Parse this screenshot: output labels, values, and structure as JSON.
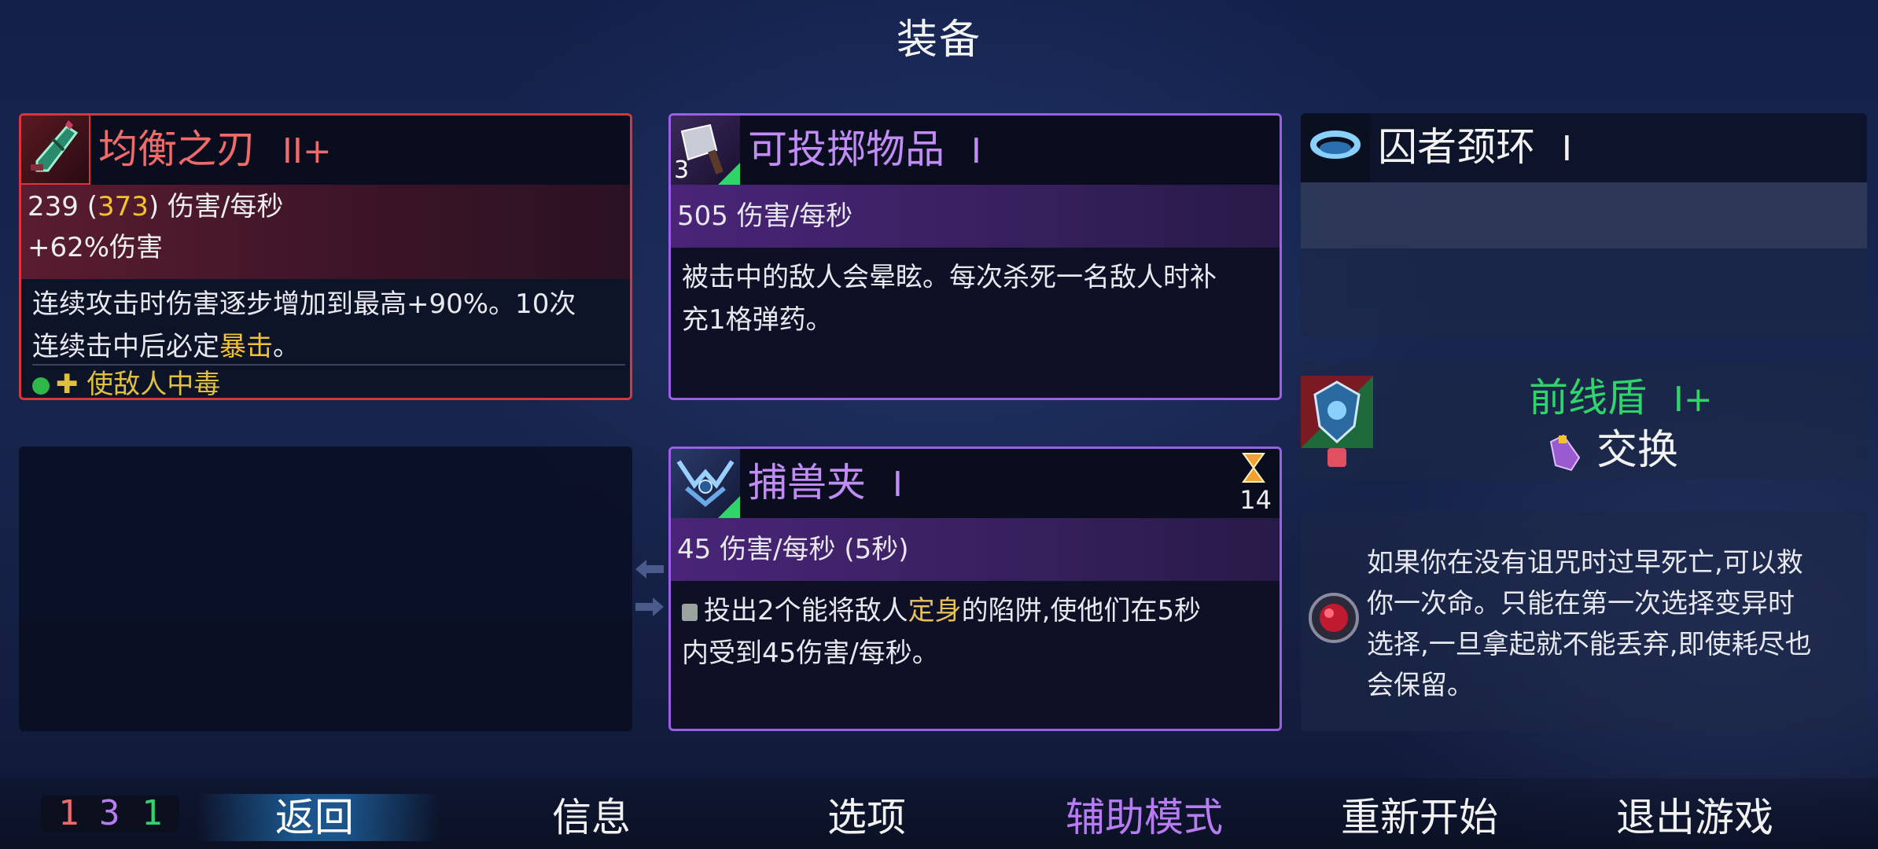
{
  "title": "装备",
  "weapon1": {
    "name": "均衡之刃",
    "tier": "II+",
    "dps_base": "239",
    "dps_paren_open": " (",
    "dps_bonus": "373",
    "dps_paren_close": ")",
    "dps_unit": " 伤害/每秒",
    "stat": "+62%伤害",
    "desc_line1": "连续攻击时伤害逐步增加到最高+90%。10次",
    "desc_line2a": "连续击中后必定",
    "desc_crit": "暴击",
    "desc_line2b": "。",
    "extra": "✚ 使敌人中毒",
    "name_color": "#f06a6a"
  },
  "skill1": {
    "name": "可投掷物品",
    "tier": "I",
    "count": "3",
    "dps": "505 伤害/每秒",
    "desc_line1": "被击中的敌人会晕眩。每次杀死一名敌人时补",
    "desc_line2": "充1格弹药。"
  },
  "skill2": {
    "name": "捕兽夹",
    "tier": "I",
    "cooldown": "14",
    "dps": "45 伤害/每秒 (5秒)",
    "desc_line1a": "投出2个能将敌人",
    "desc_keyword": "定身",
    "desc_line1b": "的陷阱,使他们在5秒",
    "desc_line2": "内受到45伤害/每秒。"
  },
  "amulet": {
    "name": "囚者颈环",
    "tier": "I"
  },
  "shield": {
    "name": "前线盾",
    "tier": "I+",
    "swap_label": "交换",
    "name_color": "#2fd46a"
  },
  "mutation": {
    "desc_line1": "如果你在没有诅咒时过早死亡,可以救",
    "desc_line2": "你一次命。只能在第一次选择变异时",
    "desc_line3": "选择,一旦拿起就不能丢弃,即使耗尽也",
    "desc_line4": "会保留。"
  },
  "scrolls": {
    "brutality": "1",
    "tactics": "3",
    "survival": "1"
  },
  "nav": {
    "back": "返回",
    "info": "信息",
    "options": "选项",
    "assist": "辅助模式",
    "restart": "重新开始",
    "quit": "退出游戏"
  },
  "colors": {
    "red_border": "#d9353b",
    "purple_border": "#9b5ee6",
    "gold": "#f2c230",
    "purple_text": "#b77cf2",
    "green": "#2fd46a"
  }
}
